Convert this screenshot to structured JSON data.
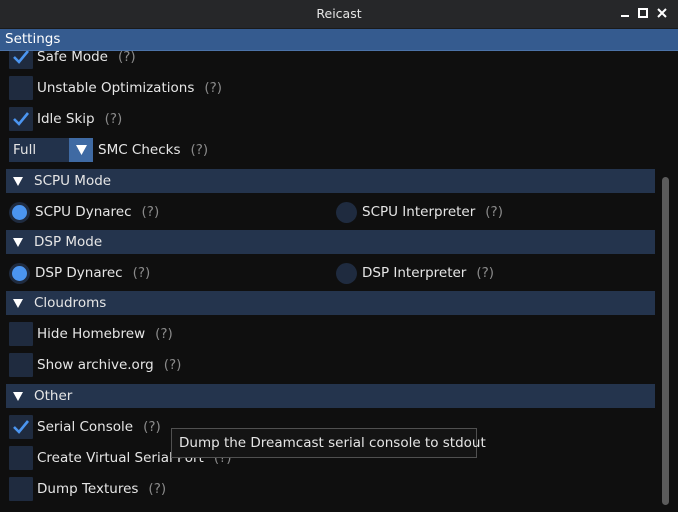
{
  "window": {
    "title": "Reicast"
  },
  "settings_header": "Settings",
  "help_marker": "(?)",
  "top_options": [
    {
      "label": "Safe Mode",
      "checked": true
    },
    {
      "label": "Unstable Optimizations",
      "checked": false
    },
    {
      "label": "Idle Skip",
      "checked": true
    }
  ],
  "smc": {
    "value": "Full",
    "label": "SMC Checks"
  },
  "sections": {
    "scpu": {
      "title": "SCPU Mode",
      "options": [
        {
          "label": "SCPU Dynarec",
          "selected": true
        },
        {
          "label": "SCPU Interpreter",
          "selected": false
        }
      ]
    },
    "dsp": {
      "title": "DSP Mode",
      "options": [
        {
          "label": "DSP Dynarec",
          "selected": true
        },
        {
          "label": "DSP Interpreter",
          "selected": false
        }
      ]
    },
    "cloudroms": {
      "title": "Cloudroms",
      "options": [
        {
          "label": "Hide Homebrew",
          "checked": false
        },
        {
          "label": "Show archive.org",
          "checked": false
        }
      ]
    },
    "other": {
      "title": "Other",
      "options": [
        {
          "label": "Serial Console",
          "checked": true
        },
        {
          "label": "Create Virtual Serial Port",
          "checked": false
        },
        {
          "label": "Dump Textures",
          "checked": false
        }
      ]
    }
  },
  "tooltip": "Dump the Dreamcast serial console to stdout",
  "colors": {
    "accent": "#4b95f0",
    "header": "#355b8f",
    "section": "#24344d",
    "checkbox": "#1f2b3f",
    "background": "#0f0f0f"
  }
}
